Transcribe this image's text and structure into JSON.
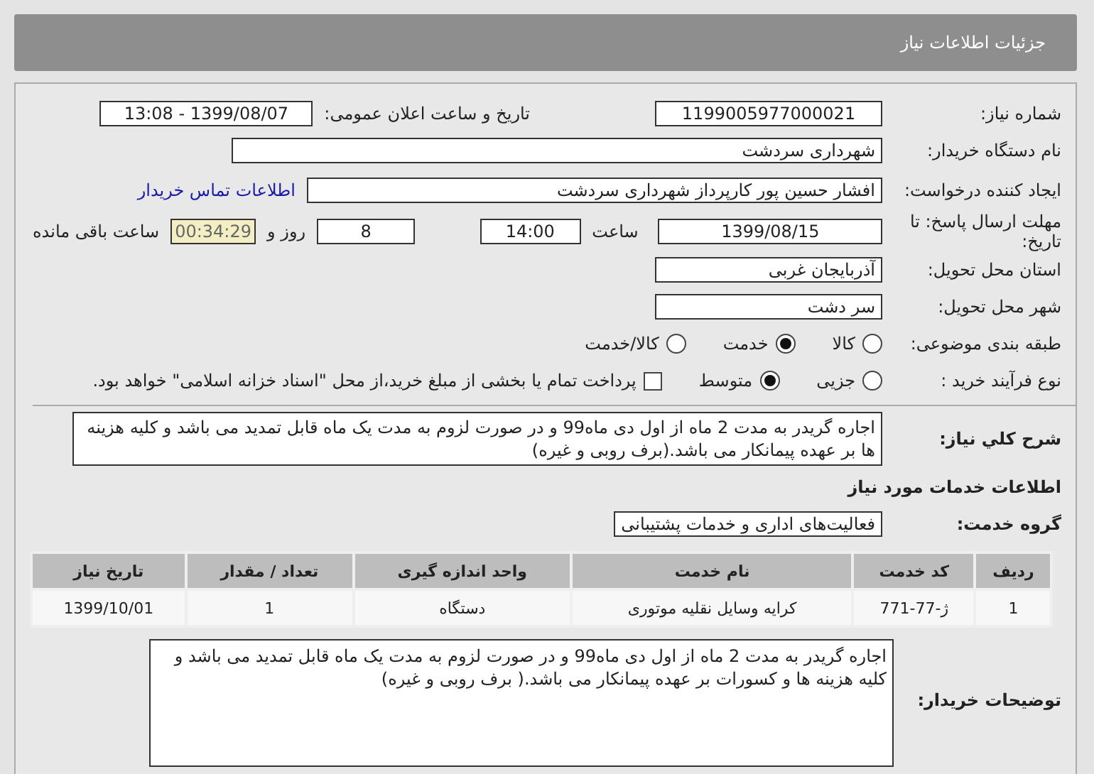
{
  "header": {
    "title": "جزئیات اطلاعات نیاز"
  },
  "need_number": {
    "label": "شماره نیاز:",
    "value": "1199005977000021"
  },
  "announce": {
    "label": "تاریخ و ساعت اعلان عمومی:",
    "value": "1399/08/07 - 13:08"
  },
  "buyer_org": {
    "label": "نام دستگاه خریدار:",
    "value": "شهرداری سردشت"
  },
  "requester": {
    "label": "ایجاد کننده درخواست:",
    "value": "افشار  حسین پور کارپرداز شهرداری سردشت",
    "link": "اطلاعات تماس خریدار"
  },
  "deadline": {
    "label": "مهلت ارسال پاسخ: تا تاریخ:",
    "date": "1399/08/15",
    "time_label": "ساعت",
    "time": "14:00",
    "days": "8",
    "days_label": "روز و",
    "remaining": "00:34:29",
    "remaining_label": "ساعت باقی مانده"
  },
  "province": {
    "label": "استان محل تحویل:",
    "value": "آذربایجان غربی"
  },
  "city": {
    "label": "شهر محل تحویل:",
    "value": "سر دشت"
  },
  "category": {
    "label": "طبقه بندی موضوعی:",
    "options": [
      {
        "label": "کالا",
        "selected": false
      },
      {
        "label": "خدمت",
        "selected": true
      },
      {
        "label": "کالا/خدمت",
        "selected": false
      }
    ]
  },
  "purchase_type": {
    "label": "نوع فرآیند خرید :",
    "options": [
      {
        "label": "جزیی",
        "selected": false
      },
      {
        "label": "متوسط",
        "selected": true
      }
    ],
    "payment": {
      "checked": false,
      "label": "پرداخت تمام یا بخشی از مبلغ خرید،از محل \"اسناد خزانه اسلامی\" خواهد بود."
    }
  },
  "description": {
    "label": "شرح کلي نياز:",
    "value": "اجاره گریدر به مدت 2 ماه از اول دی ماه99 و در صورت لزوم به مدت یک ماه قابل تمدید می باشد و کلیه هزینه ها بر عهده پیمانکار می باشد.(برف روبی و غیره)"
  },
  "services_heading": "اطلاعات خدمات مورد نیاز",
  "service_group": {
    "label": "گروه خدمت:",
    "value": "فعالیت‌های اداری و خدمات پشتیبانی"
  },
  "table": {
    "columns": [
      "ردیف",
      "کد خدمت",
      "نام خدمت",
      "واحد اندازه گیری",
      "تعداد / مقدار",
      "تاریخ نیاز"
    ],
    "rows": [
      [
        "1",
        "ژ-77-771",
        "کرایه وسایل نقلیه موتوری",
        "دستگاه",
        "1",
        "1399/10/01"
      ]
    ]
  },
  "buyer_notes": {
    "label": "توضیحات خریدار:",
    "value": "اجاره گریدر به مدت 2 ماه از اول دی ماه99 و در صورت لزوم به مدت یک ماه قابل تمدید می باشد و کلیه هزینه ها و کسورات بر عهده پیمانکار می باشد.( برف روبی و غیره)"
  }
}
